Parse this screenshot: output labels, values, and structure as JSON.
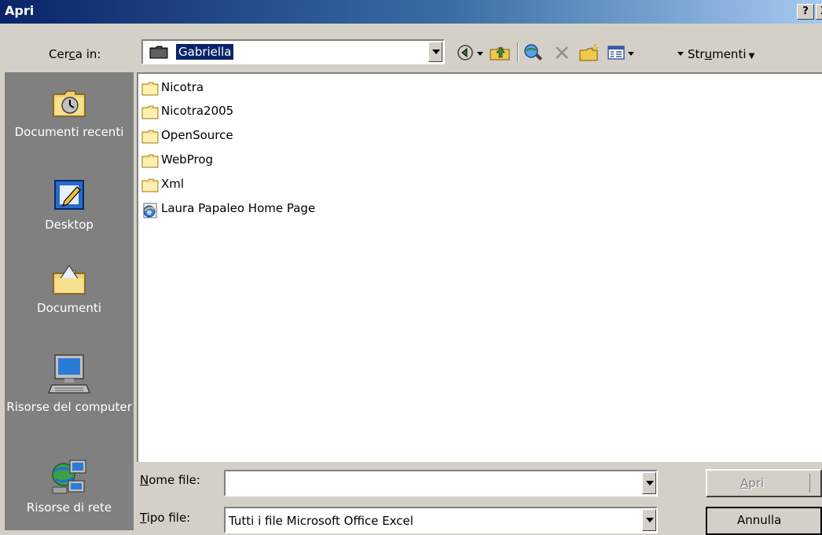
{
  "window": {
    "title": "Apri",
    "help_label": "?",
    "close_label": "X"
  },
  "lookin": {
    "label_before": "Cer",
    "label_underline": "c",
    "label_after": "a in:",
    "value": "Gabriella"
  },
  "toolbar": {
    "tools_before": "Str",
    "tools_underline": "u",
    "tools_after": "menti",
    "icons": [
      "back-icon",
      "up-folder-icon",
      "search-web-icon",
      "delete-icon",
      "new-folder-icon",
      "views-icon"
    ]
  },
  "places": [
    {
      "label": "Documenti recenti",
      "icon": "recent-documents-icon"
    },
    {
      "label": "Desktop",
      "icon": "desktop-icon"
    },
    {
      "label": "Documenti",
      "icon": "my-documents-icon"
    },
    {
      "label": "Risorse del computer",
      "icon": "my-computer-icon"
    },
    {
      "label": "Risorse di rete",
      "icon": "network-places-icon"
    }
  ],
  "files": [
    {
      "name": "Nicotra",
      "type": "folder"
    },
    {
      "name": "Nicotra2005",
      "type": "folder"
    },
    {
      "name": "OpenSource",
      "type": "folder"
    },
    {
      "name": "WebProg",
      "type": "folder"
    },
    {
      "name": "Xml",
      "type": "folder"
    },
    {
      "name": "Laura Papaleo Home Page",
      "type": "web-page"
    }
  ],
  "filename": {
    "label_underline": "N",
    "label_after": "ome file:",
    "value": ""
  },
  "filetype": {
    "label_underline": "T",
    "label_after": "ipo file:",
    "value": "Tutti i file Microsoft Office Excel"
  },
  "buttons": {
    "open_underline": "A",
    "open_after": "pri",
    "cancel_label": "Annulla"
  },
  "colors": {
    "titlebar_start": "#0a246a",
    "titlebar_end": "#a6caf0",
    "dialog_face": "#d4d0c8",
    "places_bar": "#808080",
    "selection": "#0a246a"
  }
}
